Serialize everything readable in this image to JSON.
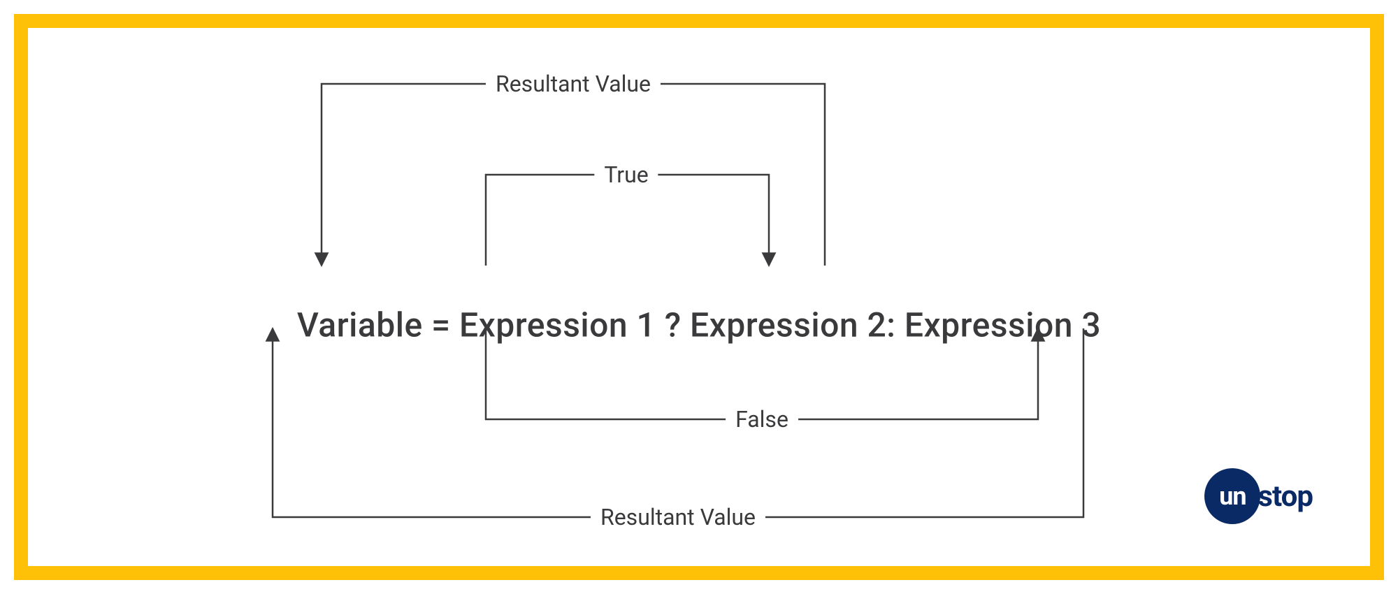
{
  "expression": {
    "full": "Variable = Expression 1 ? Expression 2: Expression 3"
  },
  "labels": {
    "resultant_top": "Resultant Value",
    "true": "True",
    "false": "False",
    "resultant_bottom": "Resultant Value"
  },
  "logo": {
    "circle": "un",
    "rest": "stop"
  },
  "colors": {
    "border": "#ffc107",
    "text": "#3a3a3c",
    "arrow": "#3a3a3c",
    "logo": "#0a2a66"
  }
}
